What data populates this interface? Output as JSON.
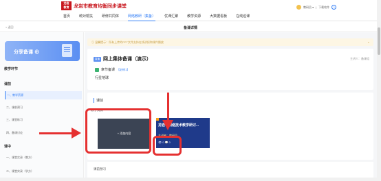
{
  "header": {
    "brand": "龙岩市教育均衡同步课堂",
    "nav": [
      "首页",
      "统对帮扶",
      "研修共同体",
      "网络教研（集备）",
      "优课汇聚",
      "教学资源",
      "大数据看板",
      "在线巡课"
    ],
    "active_nav_index": 3,
    "user": "教研员 ▾",
    "download": "下载软件"
  },
  "subbar": {
    "back": "< 返回",
    "title": "备课详情"
  },
  "sidebar": {
    "share_label": "分享备课 ⊕",
    "sections": [
      {
        "title": "教学环节",
        "items": []
      },
      {
        "title": "课前",
        "items": [
          "一、教学资源",
          "二、课前预习",
          "三、课堂练习",
          "四、备课讨论"
        ]
      },
      {
        "title": "课中",
        "items": [
          "一、课堂实录（教方）",
          "二、课堂实录（学方）"
        ]
      }
    ],
    "selected": "一、教学资源"
  },
  "main": {
    "notice": "① 温馨提示：所有上传的PPT文件支持在线讲授和课件播放",
    "notice_close": "×",
    "tag": "直播",
    "title": "网上集体备课（演示）",
    "meta": "主讲人：备课组",
    "subject_label": "章节备课",
    "subject_tag": "【必修1】",
    "subject_text": "行星地球",
    "section": "课前",
    "resource_title": "教学资源",
    "upload_label": "+ 添加内容",
    "video_title": "龙岩市网络技术教学研讨...",
    "video_author": "主讲者：教研员",
    "video_stats": "👁 0   💬 0",
    "lesson_label": "课前预习"
  }
}
